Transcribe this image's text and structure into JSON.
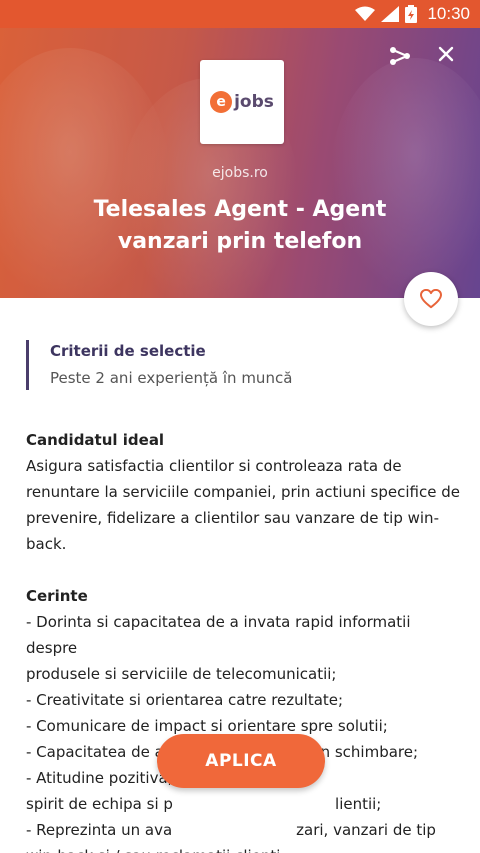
{
  "status_bar": {
    "time": "10:30"
  },
  "header": {
    "logo_letter": "e",
    "logo_text": "jobs",
    "company": "ejobs.ro",
    "job_title": "Telesales Agent - Agent vanzari prin telefon"
  },
  "criteria": {
    "title": "Criterii de selectie",
    "value": "Peste 2 ani experiență în muncă"
  },
  "description": {
    "section1_title": "Candidatul ideal",
    "section1_lines": [
      "Asigura satisfactia clientilor si controleaza rata de",
      "renuntare la serviciile companiei, prin actiuni specifice de",
      "prevenire, fidelizare a clientilor sau vanzare de tip win-back."
    ],
    "section2_title": "Cerinte",
    "section2_lines": [
      "- Dorinta si capacitatea de a invata rapid informatii despre",
      "produsele si serviciile de telecomunicatii;",
      "- Creativitate si orientarea catre rezultate;",
      "- Comunicare de impact si orientare spre solutii;",
      "- Capacitatea de a lucra intr-un mediu in schimbare;",
      "- Atitudine pozitiva,",
      "spirit de echipa si p                                  lientii;",
      "- Reprezinta un ava                          zari, vanzari de tip",
      "win-back si / sau reclamatii clienti."
    ]
  },
  "apply_button": {
    "label": "APLICA"
  },
  "colors": {
    "accent": "#f0683a",
    "criteria_border": "#4a3d6b",
    "status_bar": "#e3572f"
  },
  "icons": [
    "wifi-icon",
    "signal-icon",
    "battery-icon",
    "share-icon",
    "close-icon",
    "heart-icon"
  ]
}
